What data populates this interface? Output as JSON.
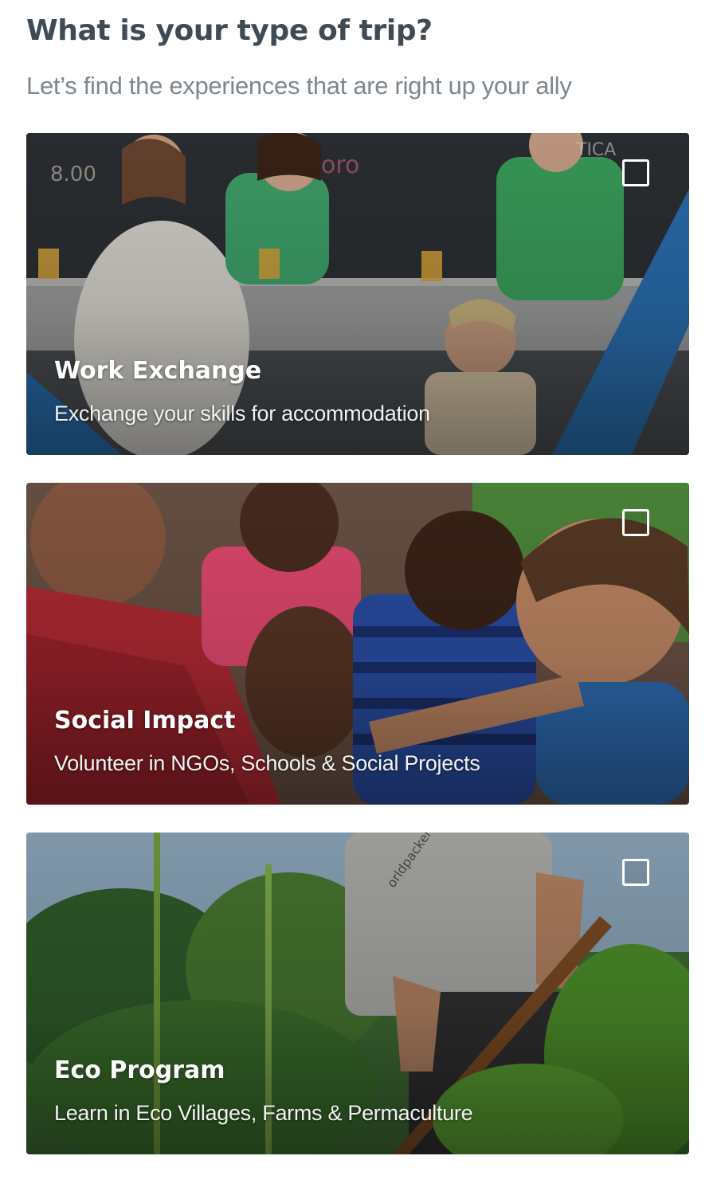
{
  "header": {
    "title": "What is your type of trip?",
    "subtitle": "Let’s find the experiences that are right up your ally"
  },
  "cards": [
    {
      "title": "Work Exchange",
      "description": "Exchange your skills for accommodation",
      "checked": false,
      "image": "friends-at-bar-with-hammock"
    },
    {
      "title": "Social Impact",
      "description": "Volunteer in NGOs, Schools & Social Projects",
      "checked": false,
      "image": "children-reading-book"
    },
    {
      "title": "Eco Program",
      "description": "Learn in Eco Villages, Farms & Permaculture",
      "checked": false,
      "image": "man-farming-in-field"
    }
  ],
  "colors": {
    "title": "#3f4b54",
    "subtitle": "#7e878d",
    "card_text": "#ffffff"
  },
  "icons": {
    "checkbox": "checkbox-unchecked-icon"
  }
}
